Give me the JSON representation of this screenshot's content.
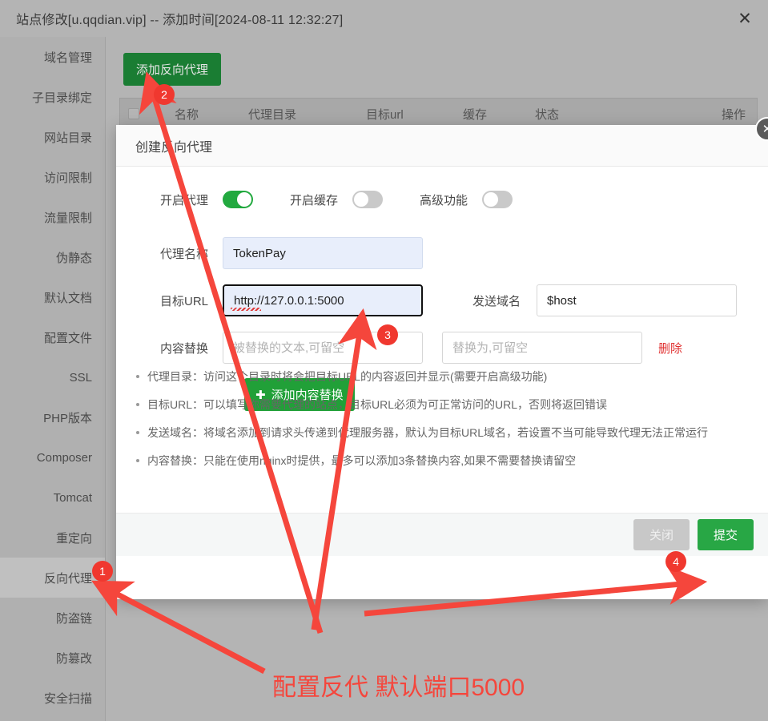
{
  "window": {
    "title": "站点修改[u.qqdian.vip] -- 添加时间[2024-08-11 12:32:27]",
    "close_icon": "close-x-icon"
  },
  "sidebar": {
    "items": [
      {
        "label": "域名管理",
        "active": false
      },
      {
        "label": "子目录绑定",
        "active": false
      },
      {
        "label": "网站目录",
        "active": false
      },
      {
        "label": "访问限制",
        "active": false
      },
      {
        "label": "流量限制",
        "active": false
      },
      {
        "label": "伪静态",
        "active": false
      },
      {
        "label": "默认文档",
        "active": false
      },
      {
        "label": "配置文件",
        "active": false
      },
      {
        "label": "SSL",
        "active": false
      },
      {
        "label": "PHP版本",
        "active": false
      },
      {
        "label": "Composer",
        "active": false
      },
      {
        "label": "Tomcat",
        "active": false
      },
      {
        "label": "重定向",
        "active": false
      },
      {
        "label": "反向代理",
        "active": true
      },
      {
        "label": "防盗链",
        "active": false
      },
      {
        "label": "防篡改",
        "active": false
      },
      {
        "label": "安全扫描",
        "active": false
      }
    ]
  },
  "page": {
    "add_proxy_button": "添加反向代理",
    "table_headers": [
      "名称",
      "代理目录",
      "目标url",
      "缓存",
      "状态",
      "操作"
    ]
  },
  "dialog": {
    "title": "创建反向代理",
    "close_icon": "circle-close-icon",
    "toggles": [
      {
        "label": "开启代理",
        "state": "on"
      },
      {
        "label": "开启缓存",
        "state": "off"
      },
      {
        "label": "高级功能",
        "state": "off"
      }
    ],
    "fields": {
      "proxy_name": {
        "label": "代理名称",
        "value": "TokenPay",
        "placeholder": ""
      },
      "target_url": {
        "label": "目标URL",
        "value": "http://127.0.0.1:5000",
        "placeholder": ""
      },
      "send_domain": {
        "label": "发送域名",
        "value": "$host",
        "placeholder": ""
      },
      "content_replace": {
        "label": "内容替换",
        "from_placeholder": "被替换的文本,可留空",
        "to_placeholder": "替换为,可留空",
        "delete_label": "删除"
      }
    },
    "add_replace_button": "添加内容替换",
    "add_replace_icon": "plus-icon",
    "tips": [
      "代理目录：访问这个目录时将会把目标URL的内容返回并显示(需要开启高级功能)",
      "目标URL：可以填写你需要代理的站点，目标URL必须为可正常访问的URL，否则将返回错误",
      "发送域名：将域名添加到请求头传递到代理服务器，默认为目标URL域名，若设置不当可能导致代理无法正常运行",
      "内容替换：只能在使用nginx时提供，最多可以添加3条替换内容,如果不需要替换请留空"
    ],
    "footer": {
      "close": "关闭",
      "submit": "提交"
    }
  },
  "annotations": {
    "badges": [
      "1",
      "2",
      "3",
      "4"
    ],
    "note": "配置反代 默认端口5000",
    "color": "#f5463c"
  }
}
